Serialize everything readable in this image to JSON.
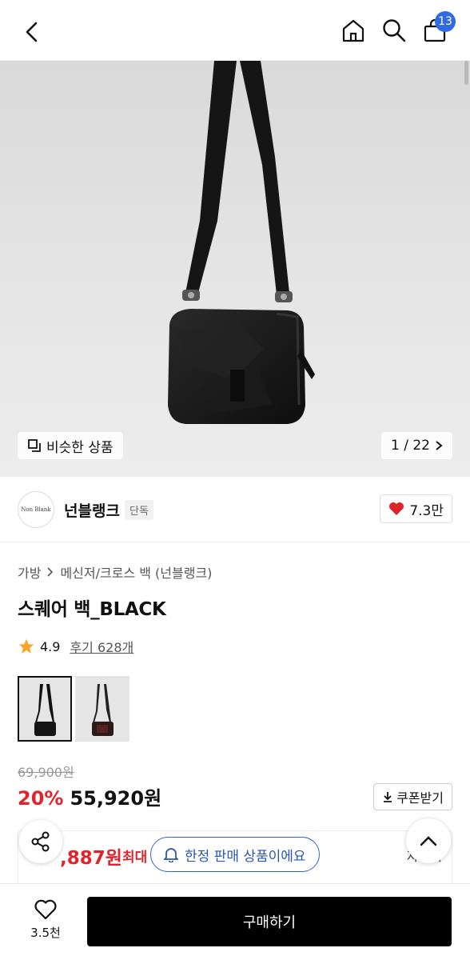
{
  "header": {
    "back_icon": "chevron-left-icon",
    "home_icon": "home-icon",
    "search_icon": "search-icon",
    "cart_icon": "cart-icon",
    "cart_count": "13",
    "badge_color": "#2f6be0"
  },
  "gallery": {
    "similar_label": "비슷한 상품",
    "page_indicator": "1 / 22"
  },
  "brand": {
    "logo_text": "Non Blank",
    "name": "넌블랭크",
    "tag": "단독",
    "like_count": "7.3만"
  },
  "breadcrumb": {
    "category": "가방",
    "subcategory": "메신저/크로스 백 (넌블랭크)"
  },
  "product": {
    "title": "스퀘어 백_BLACK",
    "rating": "4.9",
    "review_label": "후기 628개"
  },
  "price": {
    "original": "69,900원",
    "discount": "20%",
    "sale": "55,920원",
    "coupon_label": "쿠폰받기",
    "max_price": ",887원",
    "max_label": "최대",
    "detail_label": "자세히",
    "accent_color": "#e0242b"
  },
  "notice": {
    "limited_label": "한정 판매 상품이에요"
  },
  "bottom": {
    "wish_count": "3.5천",
    "buy_label": "구매하기"
  }
}
